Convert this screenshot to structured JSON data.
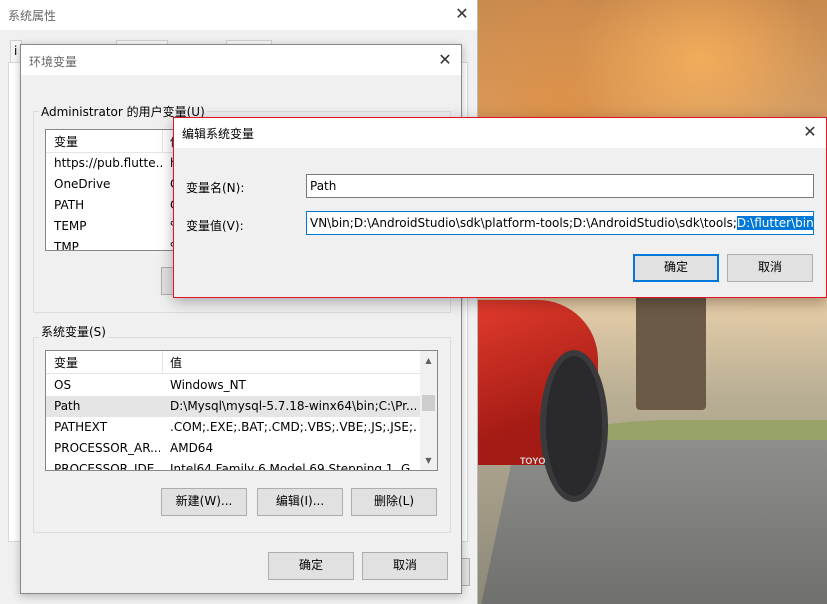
{
  "system_properties": {
    "title": "系统属性",
    "ok_label": "",
    "side_letter": "i"
  },
  "env_vars": {
    "title": "环境变量",
    "user_group_label": "Administrator 的用户变量(U)",
    "user_columns": [
      "变量",
      "值"
    ],
    "user_rows": [
      {
        "name": "https://pub.flutte...",
        "value": "h"
      },
      {
        "name": "OneDrive",
        "value": "C"
      },
      {
        "name": "PATH",
        "value": "C"
      },
      {
        "name": "TEMP",
        "value": "%"
      },
      {
        "name": "TMP",
        "value": "%"
      }
    ],
    "system_group_label": "系统变量(S)",
    "system_columns": [
      "变量",
      "值"
    ],
    "system_rows": [
      {
        "name": "OS",
        "value": "Windows_NT"
      },
      {
        "name": "Path",
        "value": "D:\\Mysql\\mysql-5.7.18-winx64\\bin;C:\\Pr..."
      },
      {
        "name": "PATHEXT",
        "value": ".COM;.EXE;.BAT;.CMD;.VBS;.VBE;.JS;.JSE;..."
      },
      {
        "name": "PROCESSOR_AR...",
        "value": "AMD64"
      },
      {
        "name": "PROCESSOR_IDE...",
        "value": "Intel64 Family 6 Model 69 Stepping 1, G..."
      }
    ],
    "selected_system_row": 1,
    "new_label": "新建(W)...",
    "edit_label": "编辑(I)...",
    "delete_label": "删除(L)",
    "ok_label": "确定",
    "cancel_label": "取消"
  },
  "edit_var": {
    "title": "编辑系统变量",
    "name_label": "变量名(N):",
    "name_value": "Path",
    "value_label": "变量值(V):",
    "value_text": "VN\\bin;D:\\AndroidStudio\\sdk\\platform-tools;D:\\AndroidStudio\\sdk\\tools;",
    "value_selected": "D:\\flutter\\bin",
    "ok_label": "确定",
    "cancel_label": "取消"
  },
  "wallpaper": {
    "tire_text": "TOYO"
  },
  "colors": {
    "accent": "#0078d7",
    "active_border": "#e81123",
    "window_bg": "#f0f0f0",
    "selected_row": "#e5e5e5"
  }
}
